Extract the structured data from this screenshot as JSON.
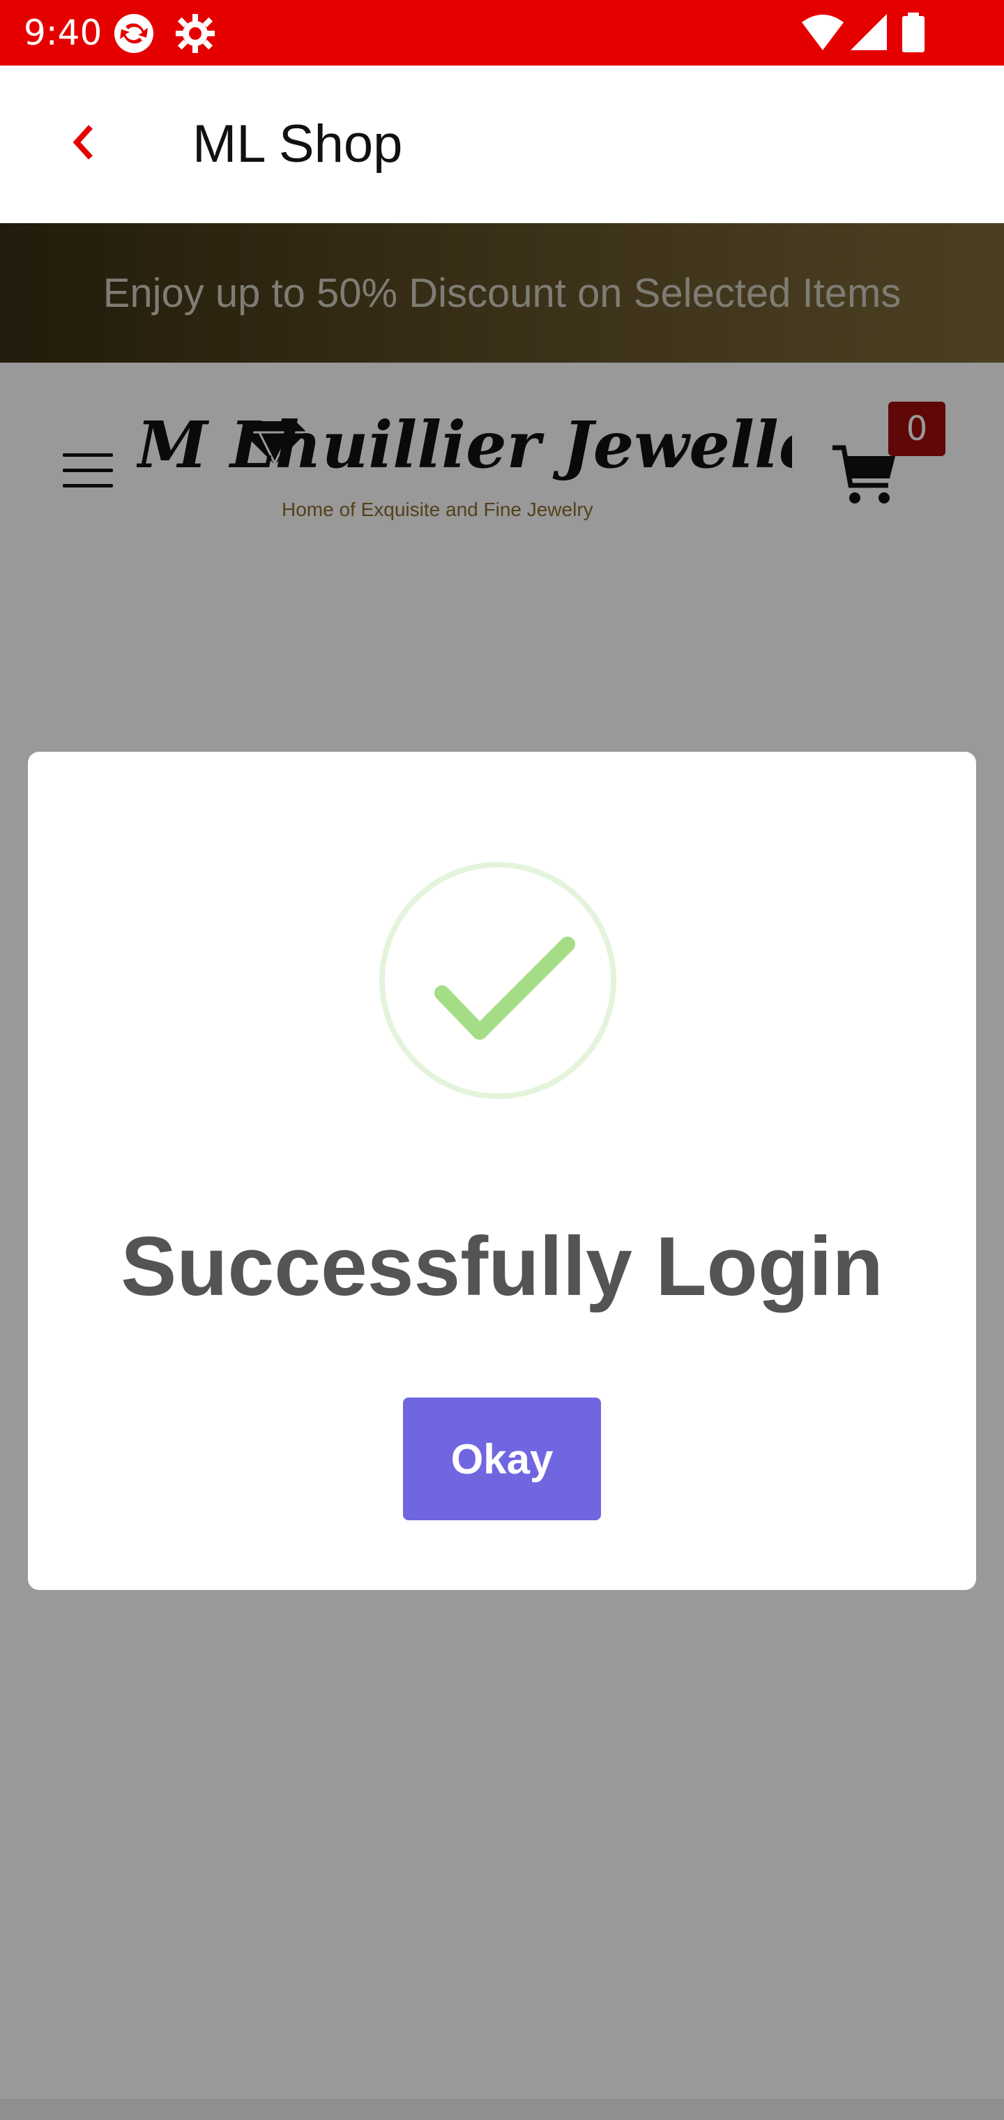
{
  "status_bar": {
    "time": "9:40",
    "icons": [
      "sync-app-icon",
      "settings-gear-icon",
      "wifi-icon",
      "signal-icon",
      "battery-icon"
    ]
  },
  "app_bar": {
    "title": "ML Shop",
    "back_icon": "chevron-left-icon"
  },
  "promo": {
    "text": "Enjoy up to 50% Discount on Selected Items"
  },
  "site_header": {
    "logo_title": "M Lhuillier Jewellers",
    "logo_tagline": "Home of Exquisite and Fine Jewelry",
    "cart_count": "0",
    "menu_icon": "hamburger-menu-icon",
    "cart_icon": "shopping-cart-icon"
  },
  "dialog": {
    "icon": "success-check-icon",
    "title": "Successfully Login",
    "button_label": "Okay"
  },
  "colors": {
    "status_bar": "#e50000",
    "back_arrow": "#e50000",
    "success_green": "#a5dc86",
    "button": "#7066e0",
    "badge": "#a10d0d",
    "title_text": "#545454"
  }
}
